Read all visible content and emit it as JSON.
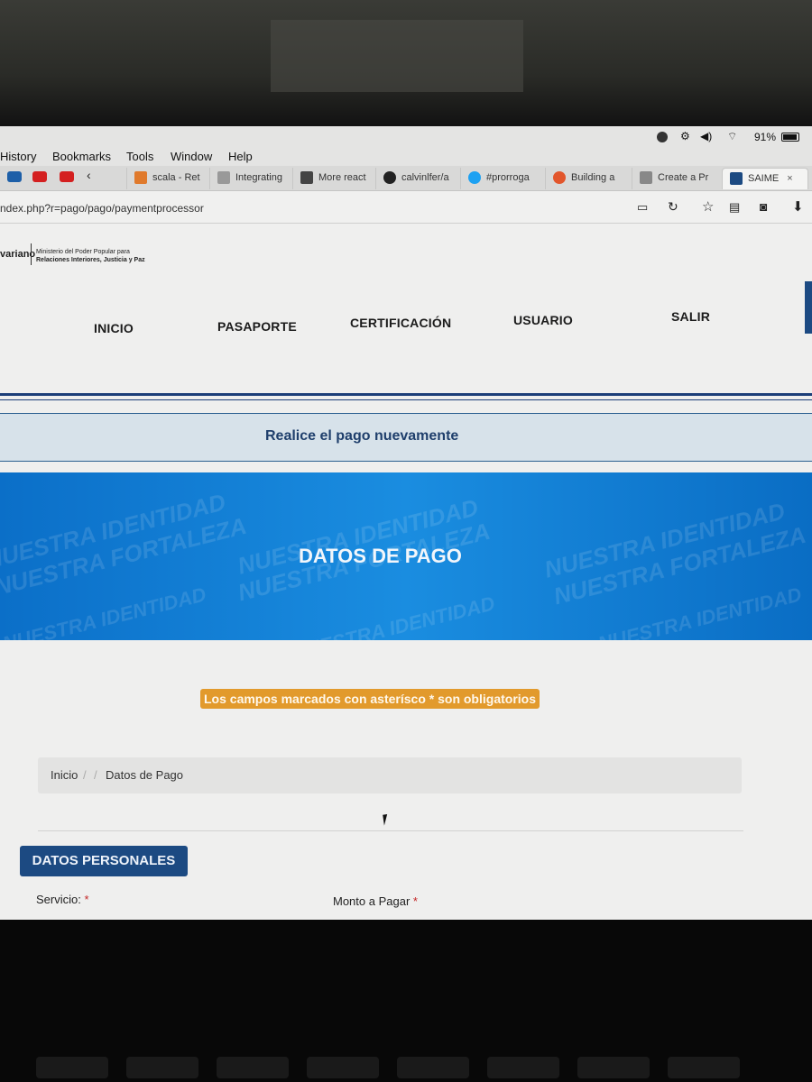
{
  "menubar": {
    "items": [
      "History",
      "Bookmarks",
      "Tools",
      "Window",
      "Help"
    ],
    "battery_text": "91%"
  },
  "tabs": [
    {
      "label": "scala - Ret",
      "icon": "stackoverflow-icon",
      "color": "#e07a2c"
    },
    {
      "label": "Integrating",
      "icon": "doc-icon",
      "color": "#888888"
    },
    {
      "label": "More react",
      "icon": "react-icon",
      "color": "#333333"
    },
    {
      "label": "calvinlfer/a",
      "icon": "github-icon",
      "color": "#222222"
    },
    {
      "label": "#prorroga",
      "icon": "twitter-icon",
      "color": "#1da1f2"
    },
    {
      "label": "Building a",
      "icon": "e-icon",
      "color": "#e2562c"
    },
    {
      "label": "Create a Pr",
      "icon": "pinwheel-icon",
      "color": "#777777"
    },
    {
      "label": "SAIME",
      "icon": "saime-icon",
      "color": "#1c4a82"
    }
  ],
  "urlbar": {
    "url": "ndex.php?r=pago/pago/paymentprocessor"
  },
  "header": {
    "brand_fragment": "variano",
    "ministry_line1": "Ministerio del Poder Popular para",
    "ministry_line2": "Relaciones Interiores, Justicia y Paz"
  },
  "nav": {
    "items": [
      "INICIO",
      "PASAPORTE",
      "CERTIFICACIÓN",
      "USUARIO",
      "SALIR"
    ]
  },
  "notice": {
    "text": "Realice el pago nuevamente"
  },
  "banner": {
    "title": "DATOS DE PAGO",
    "watermark_line1": "NUESTRA IDENTIDAD",
    "watermark_line2": "NUESTRA FORTALEZA"
  },
  "required_note": "Los campos marcados con asterísco * son obligatorios",
  "breadcrumb": {
    "home": "Inicio",
    "sep": "/",
    "current": "Datos de Pago"
  },
  "section": {
    "title": "DATOS PERSONALES"
  },
  "fields": {
    "servicio_label": "Servicio:",
    "monto_label": "Monto a Pagar",
    "asterisk": "*"
  },
  "colors": {
    "accent_blue": "#1c4a82",
    "banner_blue": "#1a8de0",
    "warning_orange": "#e29a2c",
    "notice_bg": "#d7e2ea"
  }
}
